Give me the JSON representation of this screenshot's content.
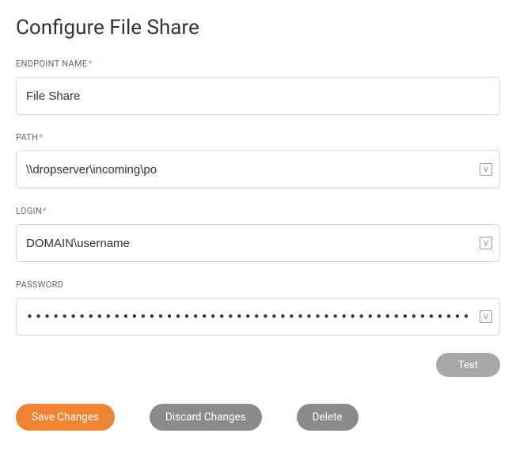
{
  "title": "Configure File Share",
  "fields": {
    "endpoint_name": {
      "label": "ENDPOINT NAME",
      "required": true,
      "value": "File Share",
      "has_suffix_icon": false
    },
    "path": {
      "label": "PATH",
      "required": true,
      "value": "\\\\dropserver\\incoming\\po",
      "has_suffix_icon": true,
      "suffix_icon": "variable-icon"
    },
    "login": {
      "label": "LOGIN",
      "required": true,
      "value": "DOMAIN\\username",
      "has_suffix_icon": true,
      "suffix_icon": "variable-icon"
    },
    "password": {
      "label": "PASSWORD",
      "required": false,
      "value": "•••••••••••••••••••••••••••••••••••••••••••••••••••••••••",
      "has_suffix_icon": true,
      "suffix_icon": "variable-icon"
    }
  },
  "buttons": {
    "test": "Test",
    "save": "Save Changes",
    "discard": "Discard Changes",
    "delete": "Delete"
  },
  "required_indicator": "*",
  "icon_glyph": "V",
  "colors": {
    "accent": "#ee8434",
    "secondary": "#8a8a8a"
  }
}
